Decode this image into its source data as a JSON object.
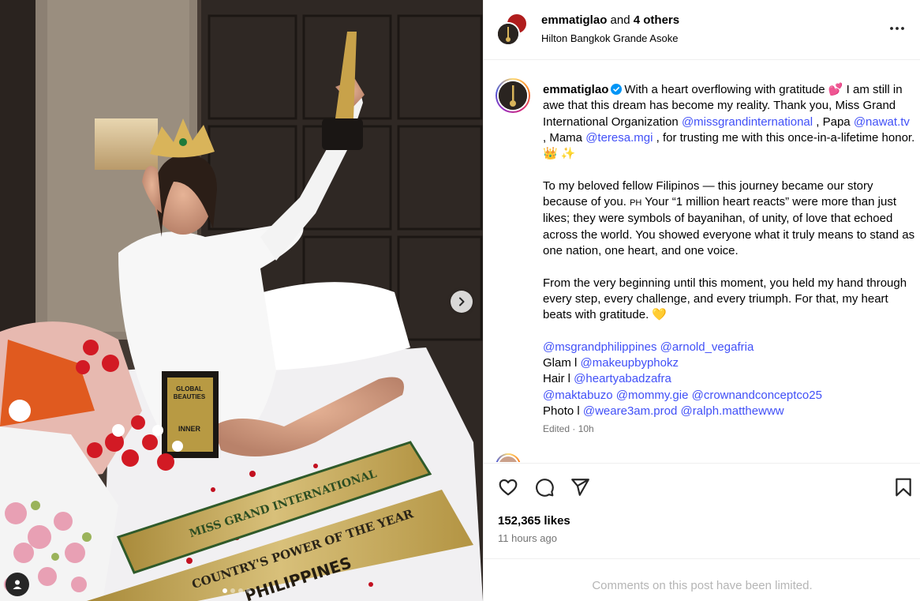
{
  "post": {
    "header": {
      "username": "emmatiglao",
      "and_text": "and",
      "others": "4 others",
      "location": "Hilton Bangkok Grande Asoke",
      "more_icon": "more-horizontal-icon"
    },
    "media": {
      "icons": {
        "next": "chevron-right-icon",
        "tag": "user-tag-icon"
      },
      "photo_text": {
        "sash_line_1": "MISS GRAND INTERNATIONAL",
        "sash_line_2": "COUNTRY'S POWER OF THE YEAR",
        "sash_line_3": "PHILIPPINES",
        "award_1": "GLOBAL",
        "award_2": "BEAUTIES",
        "award_3": "INNER"
      },
      "carousel_dots": 4,
      "active_dot": 0
    },
    "caption": {
      "username": "emmatiglao",
      "line1_a": "With a heart overflowing with gratitude ",
      "emoji_hearts": "💕",
      "line1_b": " I am still in awe that this dream has become my reality. Thank you, Miss Grand International Organization ",
      "mention_missgrand": "@missgrandinternational",
      "line1_c": " , Papa ",
      "mention_nawat": "@nawat.tv",
      "line1_d": " , Mama ",
      "mention_teresa": "@teresa.mgi",
      "line1_e": " , for trusting me with this once-in-a-lifetime honor. ",
      "emoji_crown": "👑 ✨",
      "para2_a": "To my beloved fellow Filipinos — this journey became our story because of you. ",
      "flag_ph": "PH",
      "para2_b": " Your “1 million heart reacts” were more than just likes; they were symbols of bayanihan, of unity, of love that echoed across the world. You showed everyone what it truly means to stand as one nation, one heart, and one voice.",
      "para3": "From the very beginning until this moment, you held my hand through every step, every challenge, and every triumph. For that, my heart beats with gratitude. ",
      "emoji_yellow_heart": "💛",
      "credits": {
        "line1": [
          "@msgrandphilippines",
          "@arnold_vegafria"
        ],
        "glam_label": "Glam l ",
        "glam": "@makeupbyphokz",
        "hair_label": "Hair l ",
        "hair": "@heartyabadzafra",
        "line4": [
          "@maktabuzo",
          "@mommy.gie",
          "@crownandconceptco25"
        ],
        "photo_label": "Photo l ",
        "photo": [
          "@weare3am.prod",
          "@ralph.matthewww"
        ]
      },
      "edited": "Edited · 10h"
    },
    "actions": {
      "like_icon": "heart-outline-icon",
      "comment_icon": "comment-bubble-icon",
      "share_icon": "paper-plane-icon",
      "save_icon": "bookmark-icon",
      "likes": "152,365 likes",
      "time": "11 hours ago",
      "comments_limited": "Comments on this post have been limited."
    },
    "colors": {
      "mention": "#4150f7",
      "verified": "#0095f6",
      "muted": "#737373",
      "border": "#efefef"
    }
  }
}
